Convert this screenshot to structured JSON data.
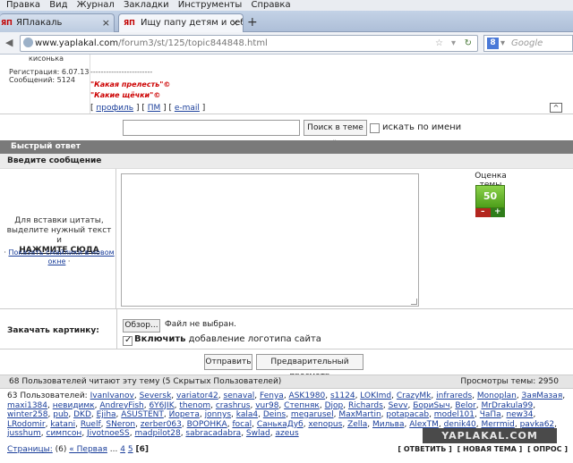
{
  "menu": [
    "Правка",
    "Вид",
    "Журнал",
    "Закладки",
    "Инструменты",
    "Справка"
  ],
  "tabs": [
    {
      "favicon": "ЯП",
      "label": "ЯПлакаль"
    },
    {
      "favicon": "ЯП",
      "label": "Ищу папу детям и себе м..."
    }
  ],
  "nav": {
    "url_domain": "www.yaplakal.com",
    "url_path": "/forum3/st/125/topic844848.html",
    "search_engine_badge": "8",
    "search_placeholder": "Google"
  },
  "post": {
    "username": "кисонька",
    "registration": "Регистрация: 6.07.13",
    "messages": "Сообщений: 5124",
    "signature_dashes": "------------------------",
    "signature_lines": [
      "\"Какая прелесть\"©",
      "\"Какие щёчки\"©"
    ],
    "links": {
      "profile": "профиль",
      "pm": "ПМ",
      "email": "e-mail"
    },
    "up_glyph": "^"
  },
  "topic_search": {
    "button": "Поиск в теме »",
    "by_name_label": "искать по имени"
  },
  "quick_reply": {
    "header": "Быстрый ответ",
    "enter_message": "Введите сообщение",
    "hint_lines": [
      "Для вставки цитаты,",
      "выделите нужный текст и"
    ],
    "hint_strong": "НАЖМИТЕ СЮДА",
    "smileys_link": "Показать смайлики в новом окне",
    "rating_title": "Оценка темы",
    "rating_value": "50",
    "rating_minus": "–",
    "rating_plus": "+",
    "upload_label": "Закачать картинку:",
    "browse_button": "Обзор...",
    "no_file": "Файл не выбран.",
    "logo_bold": "Включить",
    "logo_rest": " добавление логотипа сайта",
    "send_button": "Отправить",
    "preview_button": "Предварительный просмотр"
  },
  "readers": {
    "summary": "68 Пользователей читают эту тему (5 Скрытых Пользователей)",
    "views": "Просмотры темы: 2950",
    "users_prefix": "63 Пользователей:",
    "users": [
      "IvanIvanov",
      "Seversk",
      "variator42",
      "senaval",
      "Fenya",
      "ASK1980",
      "s1124",
      "LOKImd",
      "CrazyMk",
      "infrareds",
      "Monoplan",
      "ЗаяМазая",
      "maxi1384",
      "невидимк",
      "AndreyFish",
      "6Y6JIK",
      "thenom",
      "crashrus",
      "vur98",
      "Степняк",
      "Djop",
      "Richards",
      "Sevv",
      "БориSыч",
      "Belor",
      "MrDrakula99",
      "winter258",
      "pub",
      "DKD",
      "Ejiha",
      "ASUSTENT",
      "Иорета",
      "jonnys",
      "kala4",
      "Deins",
      "megarusel",
      "MaxMartin",
      "potapacab",
      "model101",
      "ЧаПа",
      "new34",
      "LRodomir",
      "katani",
      "Ruelf",
      "SNeron",
      "zerber063",
      "ВОРОНКА",
      "focal",
      "СанькаДуб",
      "xenopus",
      "Zella",
      "Мильва",
      "AlexTM",
      "denik40",
      "Merrmid",
      "pavka62",
      "jusshum",
      "симпсон",
      "JivotnoeSS",
      "madpilot28",
      "sabracadabra",
      "Swlad",
      "azeus"
    ]
  },
  "watermark": "YAPLAKAL.COM",
  "pagination": {
    "label": "Страницы:",
    "count": "(6)",
    "first": "« Первая",
    "ellipsis": "...",
    "page4": "4",
    "page5": "5",
    "current": "[6]"
  },
  "actions": {
    "reply": "[ ОТВЕТИТЬ ]",
    "new_topic": "[ НОВАЯ ТЕМА ]",
    "poll": "[ ОПРОС ]"
  }
}
